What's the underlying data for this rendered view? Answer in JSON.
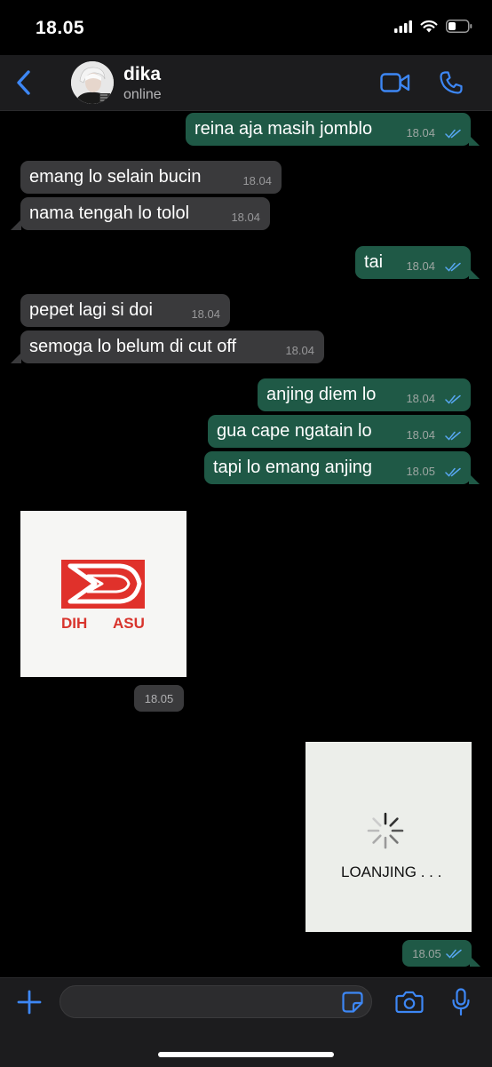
{
  "status_bar": {
    "time": "18.05"
  },
  "header": {
    "contact_name": "dika",
    "contact_status": "online"
  },
  "messages": [
    {
      "direction": "out",
      "text": "reina aja masih jomblo",
      "time": "18.04",
      "read": true
    },
    {
      "direction": "in",
      "text": "emang lo selain bucin",
      "time": "18.04"
    },
    {
      "direction": "in",
      "text": "nama tengah lo tolol",
      "time": "18.04"
    },
    {
      "direction": "out",
      "text": "tai",
      "time": "18.04",
      "read": true
    },
    {
      "direction": "in",
      "text": "pepet lagi si doi",
      "time": "18.04"
    },
    {
      "direction": "in",
      "text": "semoga lo belum di cut off",
      "time": "18.04"
    },
    {
      "direction": "out",
      "text": "anjing diem lo",
      "time": "18.04",
      "read": true
    },
    {
      "direction": "out",
      "text": "gua cape ngatain lo",
      "time": "18.04",
      "read": true
    },
    {
      "direction": "out",
      "text": "tapi lo emang anjing",
      "time": "18.05",
      "read": true
    }
  ],
  "image_messages": [
    {
      "direction": "in",
      "caption_left": "DIH",
      "caption_right": "ASU",
      "time": "18.05",
      "accent_color": "#e0312b"
    },
    {
      "direction": "out",
      "caption": "LOANJING . . .",
      "time": "18.05",
      "read": true
    }
  ],
  "colors": {
    "outgoing_bubble": "#1f5946",
    "incoming_bubble": "#3a3a3c",
    "accent": "#3d87f5",
    "read_ticks": "#57a6f0"
  },
  "icons": [
    "back-chevron-icon",
    "video-call-icon",
    "phone-icon",
    "plus-icon",
    "sticker-icon",
    "camera-icon",
    "microphone-icon"
  ]
}
